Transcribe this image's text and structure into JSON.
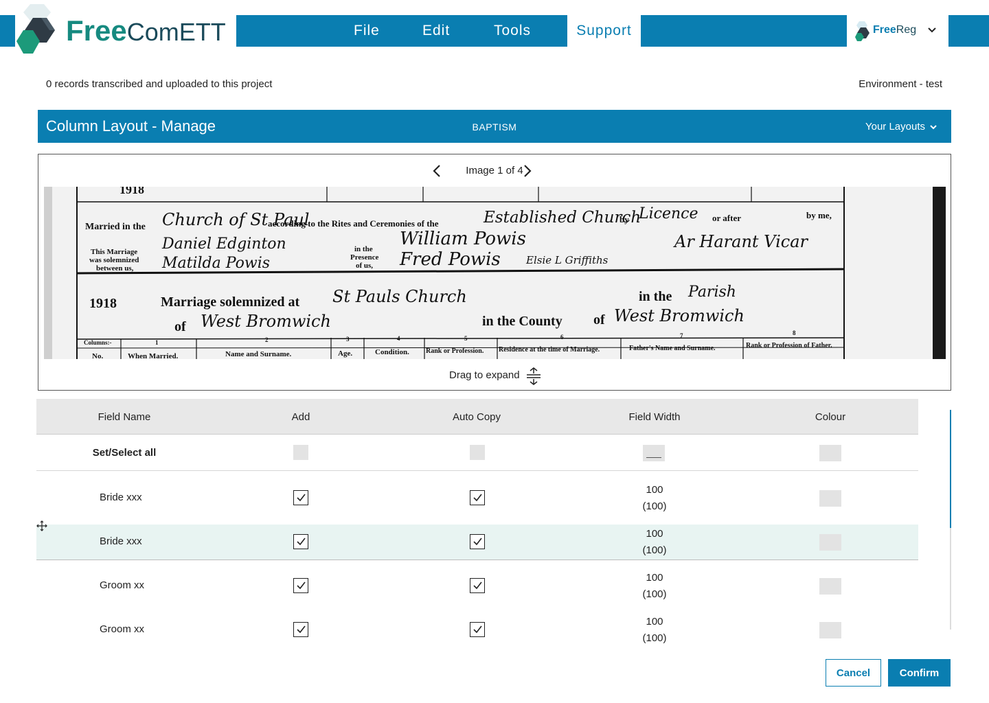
{
  "header": {
    "logo_free": "Free",
    "logo_comett": "ComETT",
    "menu": [
      {
        "label": "File"
      },
      {
        "label": "Edit"
      },
      {
        "label": "Tools"
      },
      {
        "label": "Support"
      }
    ],
    "app_switch": {
      "free": "Free",
      "reg": "Reg"
    }
  },
  "status": {
    "records": "0 records transcribed and uploaded to this project",
    "environment": "Environment - test"
  },
  "title_bar": {
    "title": "Column Layout - Manage",
    "record_type": "BAPTISM",
    "layouts": "Your Layouts"
  },
  "viewer": {
    "counter": "Image 1 of 4",
    "drag_label": "Drag to expand",
    "document": {
      "year_top": "1918",
      "married_in_the": "Married in the",
      "church_hw": "Church of St Paul",
      "according": "according to the Rites and Ceremonies of the",
      "est_church_hw": "Established Church",
      "by": "by",
      "licence_hw": "Licence",
      "or_after": "or after",
      "by_me": "by me,",
      "this_marriage": [
        "This Marriage",
        "was solemnized",
        "between us,"
      ],
      "groom_hw": "Daniel Edginton",
      "bride_hw": "Matilda Powis",
      "presence": [
        "in the",
        "Presence",
        "of us,"
      ],
      "witness1_hw": "William Powis",
      "witness2_hw": "Fred Powis",
      "witness3_hw": "Elsie L Griffiths",
      "officiant_hw": "Ar Harant Vicar",
      "year_line": "1918",
      "solemnized": "Marriage solemnized at",
      "place_hw": "St Pauls Church",
      "in_the": "in the",
      "parish_hw": "Parish",
      "of": "of",
      "town_hw": "West Bromwich",
      "in_the_county": "in the County",
      "of2": "of",
      "county_hw": "West Bromwich",
      "columns": [
        "No.",
        "When Married.",
        "Name and Surname.",
        "Age.",
        "Condition.",
        "Rank or Profession.",
        "Residence at the time of Marriage.",
        "Father's Name and Surname.",
        "Rank or Profession of Father."
      ],
      "col_numbers": [
        "Columns:-",
        "1",
        "2",
        "3",
        "4",
        "5",
        "6",
        "7",
        "8"
      ]
    }
  },
  "table": {
    "headers": {
      "field_name": "Field Name",
      "add": "Add",
      "auto_copy": "Auto Copy",
      "field_width": "Field Width",
      "colour": "Colour"
    },
    "select_all": "Set/Select all",
    "rows": [
      {
        "name": "Bride xxx",
        "add": true,
        "auto_copy": true,
        "width": "100",
        "width_default": "(100)",
        "highlighted": false
      },
      {
        "name": "Bride xxx",
        "add": true,
        "auto_copy": true,
        "width": "100",
        "width_default": "(100)",
        "highlighted": true
      },
      {
        "name": "Groom xx",
        "add": true,
        "auto_copy": true,
        "width": "100",
        "width_default": "(100)",
        "highlighted": false
      },
      {
        "name": "Groom xx",
        "add": true,
        "auto_copy": true,
        "width": "100",
        "width_default": "(100)",
        "highlighted": false
      }
    ]
  },
  "buttons": {
    "cancel": "Cancel",
    "confirm": "Confirm"
  },
  "colors": {
    "primary": "#0a7eb1",
    "brand_green": "#168a80",
    "row_highlight": "#e8f4f2",
    "header_grey": "#e8e8e8"
  },
  "icons": [
    "logo-mark-icon",
    "chevron-down-icon",
    "chevron-left-icon",
    "chevron-right-icon",
    "expand-vertical-icon",
    "checkmark-icon",
    "move-icon"
  ]
}
